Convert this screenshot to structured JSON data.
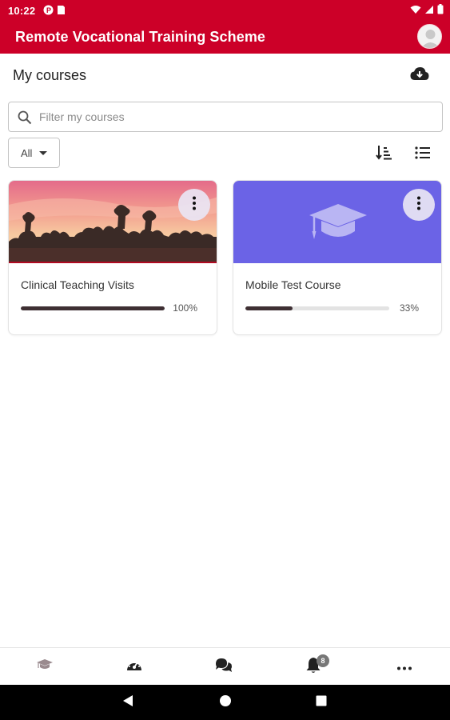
{
  "status_bar": {
    "time": "10:22",
    "left_icons": [
      "notification-p-icon",
      "sim-card-icon"
    ],
    "right_icons": [
      "wifi-icon",
      "signal-icon",
      "battery-icon"
    ]
  },
  "app_bar": {
    "title": "Remote Vocational Training Scheme",
    "avatar_icon": "user-avatar-icon"
  },
  "page": {
    "title": "My courses",
    "download_icon": "cloud-download-icon"
  },
  "search": {
    "placeholder": "Filter my courses",
    "value": ""
  },
  "filter": {
    "selected": "All"
  },
  "toolbar": {
    "sort_icon": "sort-icon",
    "view_icon": "list-view-icon"
  },
  "courses": [
    {
      "title": "Clinical Teaching Visits",
      "progress_label": "100%",
      "progress": 100,
      "image": "sunset-landscape-photo"
    },
    {
      "title": "Mobile Test Course",
      "progress_label": "33%",
      "progress": 33,
      "image": "graduation-cap-placeholder",
      "image_color": "#6b63e6"
    }
  ],
  "bottom_nav": {
    "items": [
      {
        "icon": "graduation-cap-icon",
        "active": true
      },
      {
        "icon": "dashboard-gauge-icon",
        "active": false
      },
      {
        "icon": "messages-icon",
        "active": false
      },
      {
        "icon": "notifications-bell-icon",
        "active": false,
        "badge": "8"
      },
      {
        "icon": "more-options-icon",
        "active": false
      }
    ]
  },
  "colors": {
    "brand": "#cc0028",
    "progress_fill": "#3e2f33",
    "course_placeholder": "#6b63e6"
  }
}
